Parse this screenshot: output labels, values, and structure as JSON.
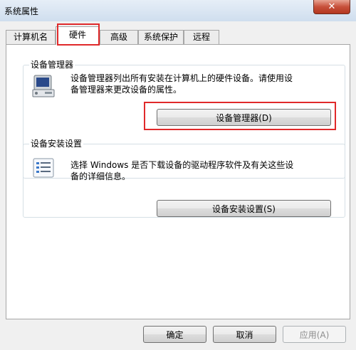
{
  "window": {
    "title": "系统属性",
    "close_label": "✕"
  },
  "tabs": [
    {
      "label": "计算机名"
    },
    {
      "label": "硬件"
    },
    {
      "label": "高级"
    },
    {
      "label": "系统保护"
    },
    {
      "label": "远程"
    }
  ],
  "active_tab": "硬件",
  "device_manager": {
    "title": "设备管理器",
    "description_line1": "设备管理器列出所有安装在计算机上的硬件设备。请使用设",
    "description_line2": "备管理器来更改设备的属性。",
    "button_label": "设备管理器(D)"
  },
  "device_install": {
    "title": "设备安装设置",
    "description_line1": "选择 Windows 是否下载设备的驱动程序软件及有关这些设",
    "description_line2": "备的详细信息。",
    "button_label": "设备安装设置(S)"
  },
  "footer": {
    "ok_label": "确定",
    "cancel_label": "取消",
    "apply_label": "应用(A)"
  },
  "colors": {
    "highlight": "#e0292a",
    "title_bar": "#cfdeee",
    "close_button": "#c7503b"
  }
}
